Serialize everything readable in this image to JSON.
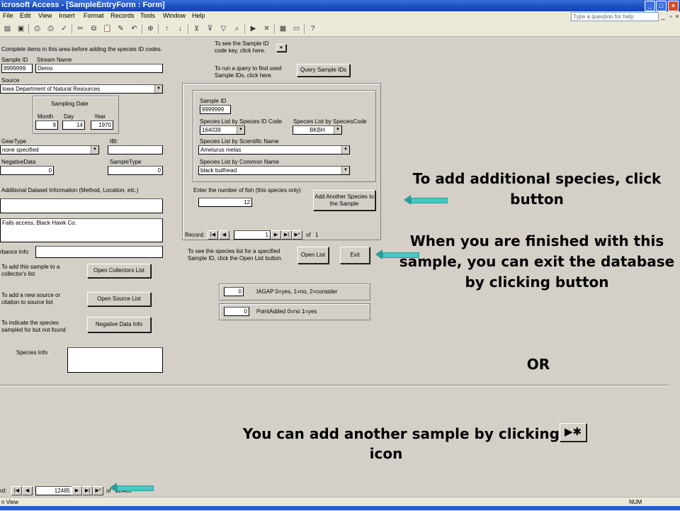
{
  "window": {
    "title": "icrosoft Access - [SampleEntryForm : Form]",
    "help_placeholder": "Type a question for help"
  },
  "menu": [
    "File",
    "Edit",
    "View",
    "Insert",
    "Format",
    "Records",
    "Tools",
    "Window",
    "Help"
  ],
  "toolbar_icons": [
    "view-icon",
    "save-icon",
    "print-preview-icon",
    "print-icon",
    "spelling-icon",
    "cut-icon",
    "copy-icon",
    "paste-icon",
    "format-painter-icon",
    "undo-icon",
    "hyperlink-icon",
    "sort-ascending-icon",
    "sort-descending-icon",
    "filter-by-selection-icon",
    "filter-by-form-icon",
    "apply-filter-icon",
    "find-icon",
    "new-record-icon",
    "delete-record-icon",
    "database-window-icon",
    "new-object-icon",
    "help-icon"
  ],
  "form": {
    "instruction": "Complete items in this area before adding the species ID codes.",
    "sample_id_label": "Sample ID",
    "sample_id": "9999999",
    "stream_name_label": "Stream Name",
    "stream_name": "Demo",
    "source_label": "Source",
    "source": "Iowa Department of Natural Resources",
    "sampling_date_label": "Sampling Date",
    "month_label": "Month",
    "day_label": "Day",
    "year_label": "Year",
    "month": "9",
    "day": "14",
    "year": "1970",
    "gear_type_label": "GearType",
    "gear_type": "none specified",
    "ibi_label": "IBI:",
    "negative_data_label": "NegativeData",
    "negative_data": "0",
    "sample_type_label": "SampleType",
    "sample_type": "0",
    "additional_info_label": "Additional Dataset Information (Method, Location, etc.)",
    "location_text": "Falls access, Black Hawk Co.",
    "disturbance_label": "rbance Info",
    "collector_text": "To add this sample to a collector's list",
    "open_collectors": "Open Collectors List",
    "source_text": "To add a new source or citation to source list",
    "open_source": "Open Source List",
    "negative_text": "To indicate the species sampled for but not found",
    "negative_info": "Negative Data Info",
    "species_info_label": "Species Info",
    "sample_key_text": "To see the Sample ID code key, click here.",
    "query_text": "To run a query to find used Sample IDs, click here.",
    "query_button": "Query Sample IDs",
    "sub_sample_id_label": "Sample ID",
    "sub_sample_id": "9999999",
    "species_by_id_label": "Species List by Species ID Code",
    "species_id": "164039",
    "species_by_code_label": "Species List by SpeciesCode",
    "species_code": "BKBH",
    "scientific_label": "Species List by Scientific Name",
    "scientific_name": "Ameiurus melas",
    "common_label": "Species List by Common Name",
    "common_name": "black bullhead",
    "fish_count_label": "Enter the number of fish (this species only)",
    "fish_count": "12",
    "add_species_button": "Add Another Species to the Sample",
    "record_label": "Record:",
    "sub_record_num": "1",
    "of_label": "of",
    "sub_record_total": "1",
    "open_list_text": "To see the species list for a specified Sample ID, click the Open List button.",
    "open_list_button": "Open List",
    "exit_button": "Exit",
    "iagap_value": "0",
    "iagap_label": "IAGAP 0=yes, 1=no, 2=consider",
    "point_value": "0",
    "point_label": "PointAdded 0=no 1=yes",
    "main_record_label": "rd:",
    "main_record_num": "12485",
    "main_of_label": "of",
    "main_record_total": "12485"
  },
  "annotations": {
    "add_species": "To add additional species, click button",
    "exit_text": "When you are finished with this sample, you can exit the database by clicking button",
    "or": "OR",
    "add_sample": "You can add another sample by clicking",
    "add_sample_2": "icon"
  },
  "status": {
    "left": "n View",
    "num": "NUM"
  },
  "colors": {
    "arrow": "#49c7c2",
    "title_bar": "#1a4fc0"
  }
}
